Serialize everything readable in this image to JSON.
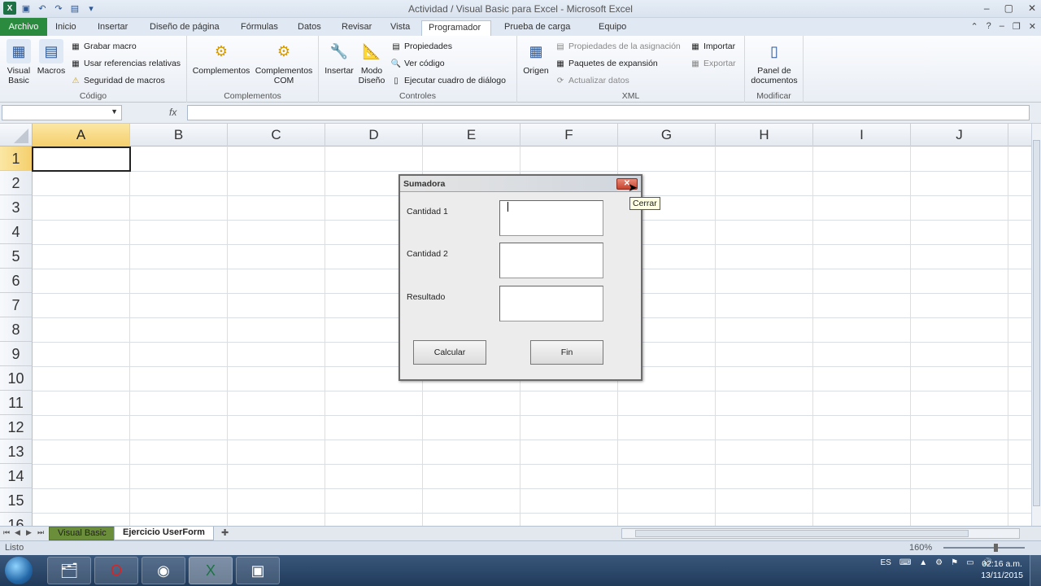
{
  "window": {
    "title": "Actividad / Visual Basic para Excel - Microsoft Excel",
    "controls": [
      "–",
      "▢",
      "✕"
    ]
  },
  "ribbon_tabs": [
    "Archivo",
    "Inicio",
    "Insertar",
    "Diseño de página",
    "Fórmulas",
    "Datos",
    "Revisar",
    "Vista",
    "Programador",
    "Prueba de carga",
    "Equipo"
  ],
  "active_tab": "Programador",
  "ribbon": {
    "codigo": {
      "label": "Código",
      "visual_basic": "Visual\nBasic",
      "macros": "Macros",
      "grabar_macro": "Grabar macro",
      "usar_referencias": "Usar referencias relativas",
      "seguridad_macros": "Seguridad de macros"
    },
    "complementos": {
      "label": "Complementos",
      "complementos": "Complementos",
      "complementos_com": "Complementos\nCOM"
    },
    "controles": {
      "label": "Controles",
      "insertar": "Insertar",
      "modo_diseno": "Modo\nDiseño",
      "propiedades": "Propiedades",
      "ver_codigo": "Ver código",
      "ejecutar_cuadro": "Ejecutar cuadro de diálogo"
    },
    "xml": {
      "label": "XML",
      "origen": "Origen",
      "propiedades_asignacion": "Propiedades de la asignación",
      "paquetes_expansion": "Paquetes de expansión",
      "actualizar_datos": "Actualizar datos",
      "importar": "Importar",
      "exportar": "Exportar"
    },
    "modificar": {
      "label": "Modificar",
      "panel_documentos": "Panel de\ndocumentos"
    }
  },
  "formula_bar": {
    "name_box": "",
    "fx": "fx",
    "formula": ""
  },
  "grid": {
    "columns": [
      "A",
      "B",
      "C",
      "D",
      "E",
      "F",
      "G",
      "H",
      "I",
      "J"
    ],
    "rows": [
      "1",
      "2",
      "3",
      "4",
      "5",
      "6",
      "7",
      "8",
      "9",
      "10",
      "11",
      "12",
      "13",
      "14",
      "15",
      "16"
    ],
    "active_cell": "A1"
  },
  "sheets": {
    "tabs": [
      "Visual Basic",
      "Ejercicio UserForm"
    ],
    "active": "Ejercicio UserForm"
  },
  "status": {
    "ready": "Listo",
    "zoom": "160%"
  },
  "userform": {
    "title": "Sumadora",
    "label1": "Cantidad 1",
    "label2": "Cantidad 2",
    "label3": "Resultado",
    "value1": "",
    "value2": "",
    "value3": "",
    "btn_calcular": "Calcular",
    "btn_fin": "Fin",
    "close_tooltip": "Cerrar"
  },
  "taskbar": {
    "lang": "ES",
    "time": "02:16 a.m.",
    "date": "13/11/2015"
  },
  "colors": {
    "archivo_tab": "#2a8b3f",
    "selected_header": "#f5cf6c",
    "visual_basic_tab": "#6b8e3a"
  }
}
